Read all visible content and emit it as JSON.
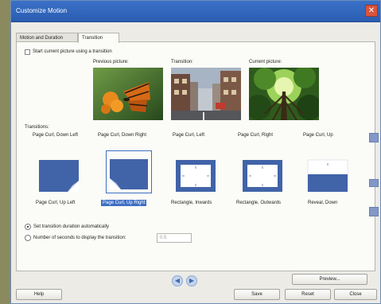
{
  "window": {
    "title": "Customize Motion",
    "close_glyph": "✕"
  },
  "tabs": [
    {
      "label": "Motion and Duration"
    },
    {
      "label": "Transition"
    }
  ],
  "transition_panel": {
    "start_checkbox_label": "Start current picture using a transition",
    "previews": {
      "previous_caption": "Previous picture:",
      "transition_caption": "Transition:",
      "current_caption": "Current picture:"
    },
    "section_label": "Transitions:",
    "gallery_top_labels": [
      "Page Curl, Down Left",
      "Page Curl, Down Right",
      "Page Curl, Left",
      "Page Curl, Right",
      "Page Curl, Up"
    ],
    "gallery_items": [
      {
        "label": "Page Curl, Up Left",
        "selected": false
      },
      {
        "label": "Page Curl, Up Right",
        "selected": true
      },
      {
        "label": "Rectangle, Inwards",
        "selected": false
      },
      {
        "label": "Rectangle, Outwards",
        "selected": false
      },
      {
        "label": "Reveal, Down",
        "selected": false
      }
    ],
    "options": {
      "auto_duration_label": "Set transition duration automatically",
      "seconds_label": "Number of seconds to display the transition:",
      "seconds_value": "0.5"
    }
  },
  "footer": {
    "preview_label": "Preview...",
    "help_label": "Help",
    "save_label": "Save",
    "reset_label": "Reset",
    "close_label": "Close",
    "prev_glyph": "◀",
    "next_glyph": "▶"
  },
  "colors": {
    "titlebar": "#2a5db0",
    "selection": "#3e6fc4",
    "icon_fill": "#4163a8"
  }
}
